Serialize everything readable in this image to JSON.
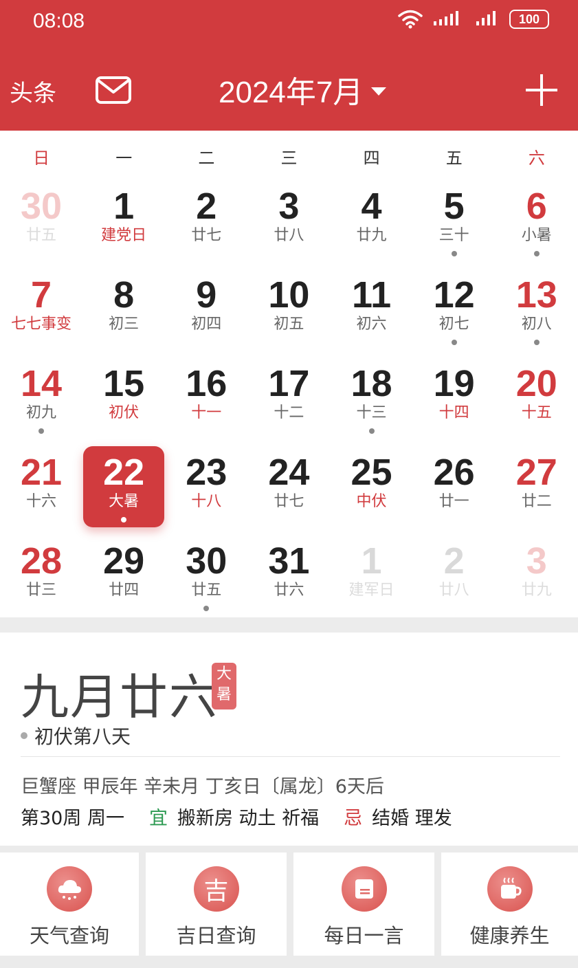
{
  "status_bar": {
    "time": "08:08",
    "battery": "100"
  },
  "header": {
    "left_label": "头条",
    "month_title": "2024年7月"
  },
  "weekdays": [
    "日",
    "一",
    "二",
    "三",
    "四",
    "五",
    "六"
  ],
  "days": [
    {
      "num": "30",
      "lunar": "廿五",
      "style": "faded-red"
    },
    {
      "num": "1",
      "lunar": "建党日",
      "lunar_red": true
    },
    {
      "num": "2",
      "lunar": "廿七"
    },
    {
      "num": "3",
      "lunar": "廿八"
    },
    {
      "num": "4",
      "lunar": "廿九"
    },
    {
      "num": "5",
      "lunar": "三十",
      "dot": true
    },
    {
      "num": "6",
      "lunar": "小暑",
      "weekend": true,
      "dot": true
    },
    {
      "num": "7",
      "lunar": "七七事变",
      "weekend": true,
      "lunar_red": true
    },
    {
      "num": "8",
      "lunar": "初三"
    },
    {
      "num": "9",
      "lunar": "初四"
    },
    {
      "num": "10",
      "lunar": "初五"
    },
    {
      "num": "11",
      "lunar": "初六"
    },
    {
      "num": "12",
      "lunar": "初七",
      "dot": true
    },
    {
      "num": "13",
      "lunar": "初八",
      "weekend": true,
      "dot": true
    },
    {
      "num": "14",
      "lunar": "初九",
      "weekend": true,
      "dot": true
    },
    {
      "num": "15",
      "lunar": "初伏",
      "lunar_red": true
    },
    {
      "num": "16",
      "lunar": "十一",
      "lunar_red": true
    },
    {
      "num": "17",
      "lunar": "十二"
    },
    {
      "num": "18",
      "lunar": "十三",
      "dot": true
    },
    {
      "num": "19",
      "lunar": "十四",
      "lunar_red": true
    },
    {
      "num": "20",
      "lunar": "十五",
      "weekend": true,
      "lunar_red": true
    },
    {
      "num": "21",
      "lunar": "十六",
      "weekend": true
    },
    {
      "num": "22",
      "lunar": "大暑",
      "selected": true,
      "dot": true
    },
    {
      "num": "23",
      "lunar": "十八",
      "lunar_red": true
    },
    {
      "num": "24",
      "lunar": "廿七"
    },
    {
      "num": "25",
      "lunar": "中伏",
      "lunar_red": true
    },
    {
      "num": "26",
      "lunar": "廿一"
    },
    {
      "num": "27",
      "lunar": "廿二",
      "weekend": true
    },
    {
      "num": "28",
      "lunar": "廿三",
      "weekend": true
    },
    {
      "num": "29",
      "lunar": "廿四"
    },
    {
      "num": "30",
      "lunar": "廿五",
      "dot": true
    },
    {
      "num": "31",
      "lunar": "廿六"
    },
    {
      "num": "1",
      "lunar": "建军日",
      "style": "faded"
    },
    {
      "num": "2",
      "lunar": "廿八",
      "style": "faded"
    },
    {
      "num": "3",
      "lunar": "廿九",
      "style": "faded-red"
    }
  ],
  "info": {
    "lunar_date": "九月廿六",
    "seal": [
      "大",
      "暑"
    ],
    "fu_text": "初伏第八天",
    "ganzhi": "巨蟹座 甲辰年 辛未月 丁亥日〔属龙〕6天后",
    "week": "第30周 周一",
    "yi_label": "宜",
    "yi_items": "搬新房 动土 祈福",
    "ji_label": "忌",
    "ji_items": "结婚 理发"
  },
  "tools": [
    {
      "label": "天气查询",
      "icon": "weather-icon"
    },
    {
      "label": "吉日查询",
      "icon": "ji-icon",
      "glyph": "吉"
    },
    {
      "label": "每日一言",
      "icon": "note-icon"
    },
    {
      "label": "健康养生",
      "icon": "tea-cup-icon"
    }
  ],
  "colors": {
    "accent": "#d13b3e",
    "yi": "#2c9a52"
  }
}
